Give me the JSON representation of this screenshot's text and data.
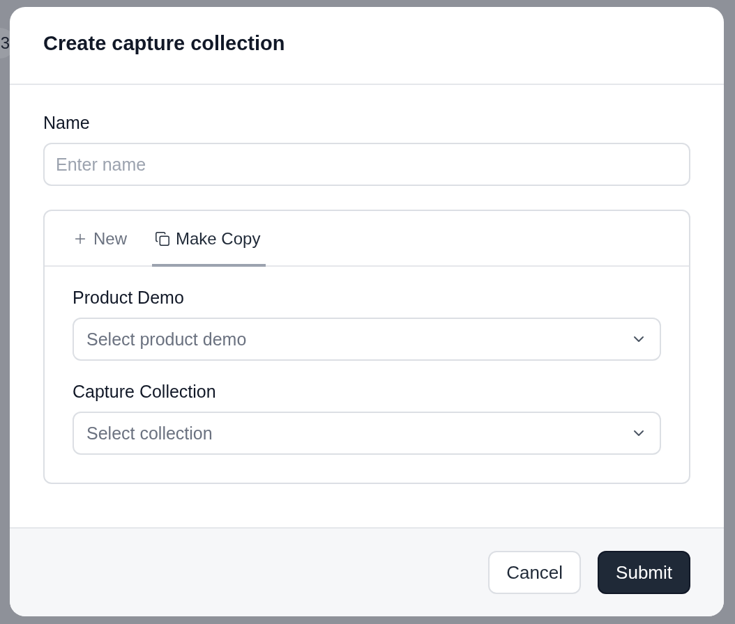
{
  "backdrop": {
    "avatar": "3"
  },
  "dialog": {
    "title": "Create capture collection",
    "name_field": {
      "label": "Name",
      "placeholder": "Enter name"
    },
    "tabs": [
      {
        "label": "New",
        "kind": "new",
        "selected": false
      },
      {
        "label": "Make Copy",
        "kind": "copy",
        "selected": true
      }
    ],
    "selects": [
      {
        "label": "Product Demo",
        "placeholder": "Select product demo"
      },
      {
        "label": "Capture Collection",
        "placeholder": "Select collection"
      }
    ],
    "buttons": [
      {
        "label": "Cancel",
        "kind": "secondary"
      },
      {
        "label": "Submit",
        "kind": "primary"
      }
    ]
  }
}
